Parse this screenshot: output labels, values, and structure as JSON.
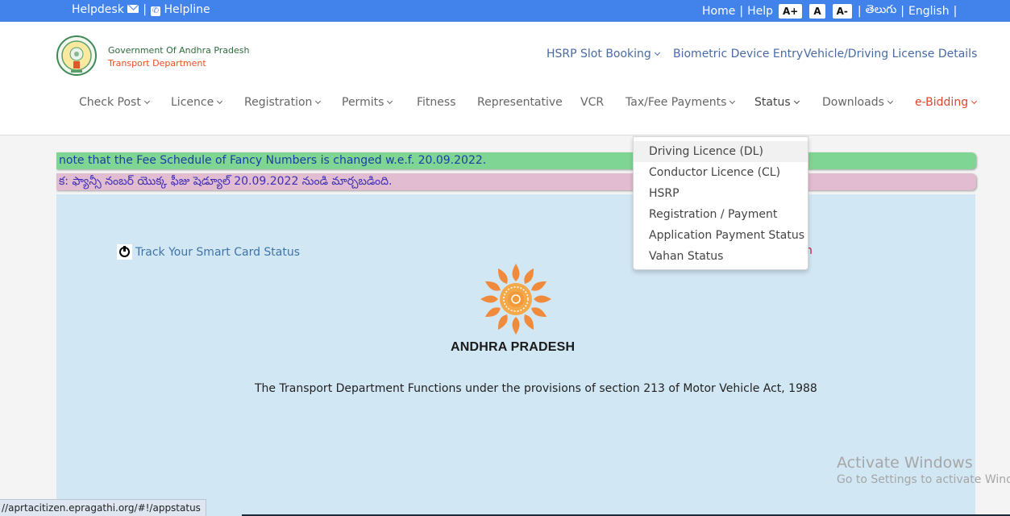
{
  "topbar": {
    "helpdesk": "Helpdesk",
    "separator": "|",
    "helpline": "Helpline",
    "home": "Home",
    "help": "Help",
    "font_increase": "A+",
    "font_normal": "A",
    "font_decrease": "A-",
    "telugu": "తెలుగు",
    "english": "English"
  },
  "header": {
    "gov_name": "Government Of Andhra Pradesh",
    "dept_name": "Transport Department",
    "subnav": {
      "hsrp": "HSRP Slot Booking",
      "biometric": "Biometric Device Entry",
      "vehicle_details": "Vehicle/Driving License Details"
    },
    "mainnav": [
      {
        "label": "Check Post",
        "dropdown": true
      },
      {
        "label": "Licence",
        "dropdown": true
      },
      {
        "label": "Registration",
        "dropdown": true
      },
      {
        "label": "Permits",
        "dropdown": true
      },
      {
        "label": "Fitness",
        "dropdown": false
      },
      {
        "label": "Representative",
        "dropdown": false
      },
      {
        "label": "VCR",
        "dropdown": false
      },
      {
        "label": "Tax/Fee Payments",
        "dropdown": true
      },
      {
        "label": "Status",
        "dropdown": true
      },
      {
        "label": "Downloads",
        "dropdown": true
      },
      {
        "label": "e-Bidding",
        "dropdown": true
      }
    ]
  },
  "status_dropdown": {
    "items": [
      "Driving Licence (DL)",
      "Conductor Licence (CL)",
      "HSRP",
      "Registration / Payment",
      "Application Payment Status",
      "Vahan Status"
    ],
    "highlighted_index": 0
  },
  "notices": {
    "english": "note that the Fee Schedule of Fancy Numbers is changed w.e.f. 20.09.2022.",
    "telugu": "క: ఫ్యాన్సీ నంబర్ యొక్క ఫీజు షెడ్యూల్ 20.09.2022 నుండి మార్చబడింది."
  },
  "content": {
    "track_link": "Track Your Smart Card Status",
    "partial_red_text": "n",
    "ap_logo_text": "ANDHRA PRADESH",
    "provision_text": "The Transport Department Functions under the provisions of section 213 of Motor Vehicle Act, 1988"
  },
  "watermark": {
    "title": "Activate Windows",
    "subtitle": "Go to Settings to activate Windo"
  },
  "status_url": "//aprtacitizen.epragathi.org/#!/appstatus",
  "colors": {
    "topbar_bg": "#4183eb",
    "brand_green": "#2f6b3c",
    "brand_orange": "#e8501f",
    "link_blue": "#4a6aa5",
    "ebidding_red": "#e0452b",
    "notice_green": "#7fd593",
    "notice_pink": "#e2bcd0",
    "content_bg": "#d2e7f4"
  }
}
